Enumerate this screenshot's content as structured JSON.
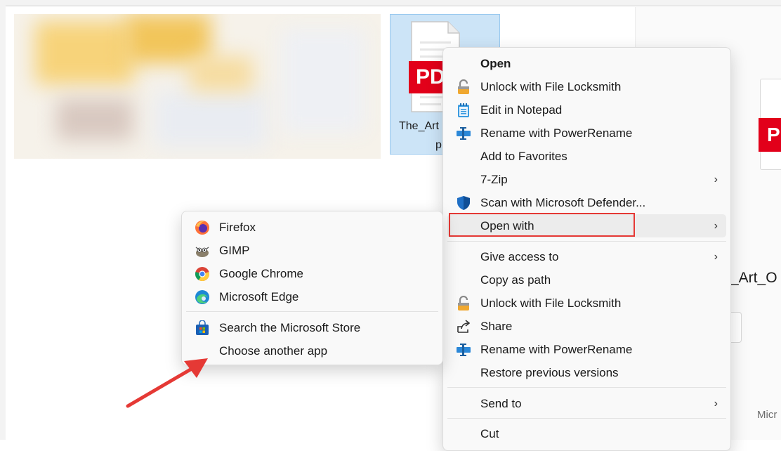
{
  "file": {
    "name_line1": "The_Art",
    "name_line2": "p",
    "badge_text": "PD"
  },
  "right_pane": {
    "pdf_badge": "P",
    "file_name": "_Art_O",
    "footer_text": "Micr"
  },
  "context_menu": {
    "items": [
      {
        "label": "Open",
        "icon": "none",
        "bold": true
      },
      {
        "label": "Unlock with File Locksmith",
        "icon": "lock-icon"
      },
      {
        "label": "Edit in Notepad",
        "icon": "notepad-icon"
      },
      {
        "label": "Rename with PowerRename",
        "icon": "powerrename-icon"
      },
      {
        "label": "Add to Favorites",
        "icon": "none"
      },
      {
        "label": "7-Zip",
        "icon": "none",
        "submenu": true
      },
      {
        "label": "Scan with Microsoft Defender...",
        "icon": "defender-shield-icon"
      },
      {
        "label": "Open with",
        "icon": "none",
        "submenu": true,
        "highlighted": true
      },
      {
        "label": "Give access to",
        "icon": "none",
        "submenu": true
      },
      {
        "label": "Copy as path",
        "icon": "none"
      },
      {
        "label": "Unlock with File Locksmith",
        "icon": "lock-icon"
      },
      {
        "label": "Share",
        "icon": "share-icon"
      },
      {
        "label": "Rename with PowerRename",
        "icon": "powerrename-icon"
      },
      {
        "label": "Restore previous versions",
        "icon": "none"
      },
      {
        "label": "Send to",
        "icon": "none",
        "submenu": true
      },
      {
        "label": "Cut",
        "icon": "none"
      }
    ],
    "chevron": "›"
  },
  "open_with_menu": {
    "items": [
      {
        "label": "Firefox",
        "icon": "firefox-icon"
      },
      {
        "label": "GIMP",
        "icon": "gimp-icon"
      },
      {
        "label": "Google Chrome",
        "icon": "chrome-icon"
      },
      {
        "label": "Microsoft Edge",
        "icon": "edge-icon"
      },
      {
        "label": "Search the Microsoft Store",
        "icon": "microsoft-store-icon"
      },
      {
        "label": "Choose another app",
        "icon": "none"
      }
    ]
  },
  "annotation": {
    "arrow_color": "#e53935",
    "highlight_color": "#e53935"
  }
}
